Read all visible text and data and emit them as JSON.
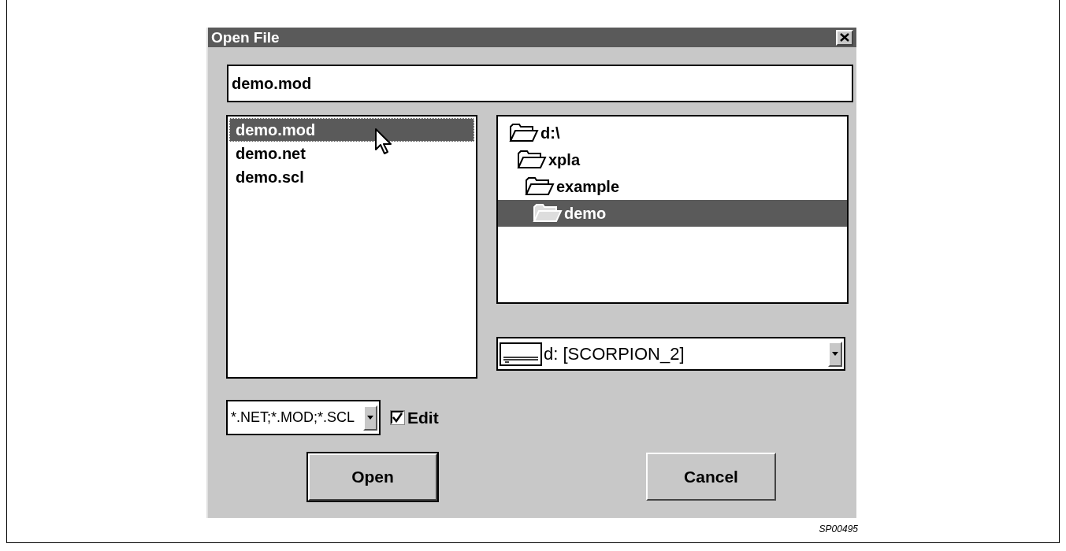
{
  "window": {
    "title": "Open File"
  },
  "file_name": {
    "value": "demo.mod"
  },
  "files": [
    {
      "name": "demo.mod",
      "selected": true
    },
    {
      "name": "demo.net",
      "selected": false
    },
    {
      "name": "demo.scl",
      "selected": false
    }
  ],
  "folders": [
    {
      "name": "d:\\",
      "selected": false,
      "children": [
        {
          "name": "xpla",
          "selected": false,
          "children": [
            {
              "name": "example",
              "selected": false,
              "children": [
                {
                  "name": "demo",
                  "selected": true
                }
              ]
            }
          ]
        }
      ]
    }
  ],
  "drive": {
    "value": "d: [SCORPION_2]"
  },
  "filter": {
    "value": "*.NET;*.MOD;*.SCL"
  },
  "edit_checkbox": {
    "label": "Edit",
    "checked": true
  },
  "buttons": [
    {
      "label": "Open",
      "default": true
    },
    {
      "label": "Cancel",
      "default": false
    }
  ],
  "figure_code": "SP00495"
}
